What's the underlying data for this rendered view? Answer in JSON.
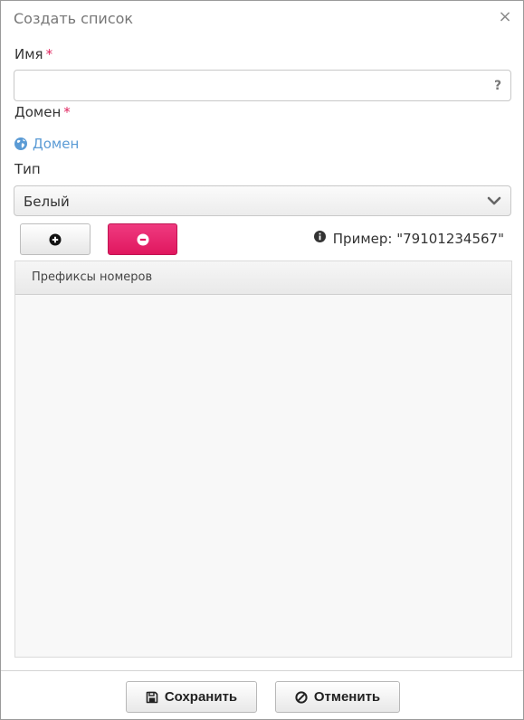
{
  "dialog": {
    "title": "Создать список",
    "close_glyph": "×"
  },
  "form": {
    "name_label": "Имя",
    "name_required": "*",
    "name_value": "",
    "name_help_glyph": "?",
    "domain_label": "Домен",
    "domain_required": "*",
    "domain_link": "Домен",
    "type_label": "Тип",
    "type_value": "Белый"
  },
  "toolbar": {
    "add_icon": "plus-circle-icon",
    "remove_icon": "minus-circle-icon",
    "example_text": "Пример: \"79101234567\""
  },
  "grid": {
    "columns": [
      "Префиксы номеров"
    ],
    "rows": []
  },
  "footer": {
    "save_label": "Сохранить",
    "cancel_label": "Отменить"
  },
  "colors": {
    "accent_pink": "#e0175f",
    "required_mark": "#e0245e",
    "link_blue": "#5b9bd5"
  }
}
